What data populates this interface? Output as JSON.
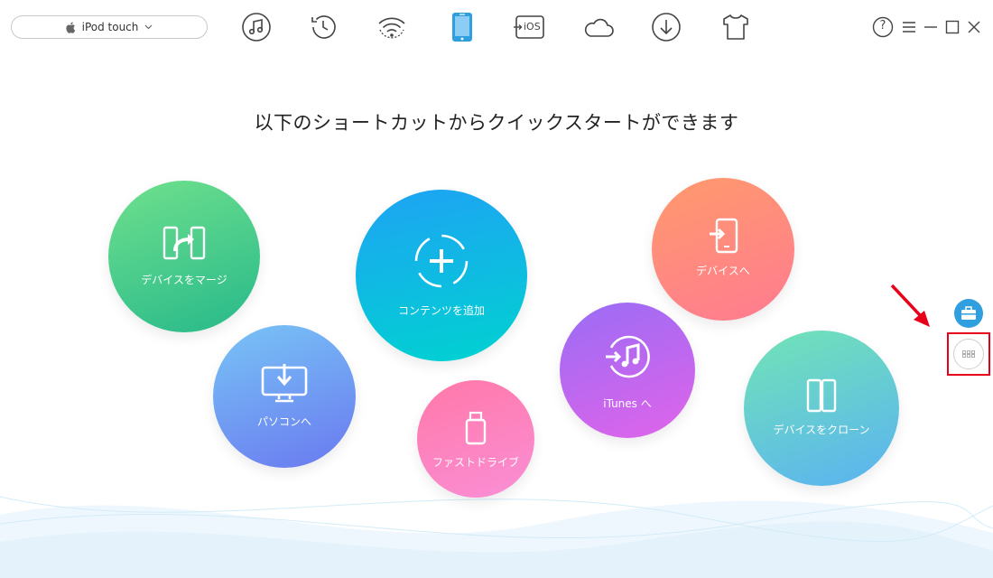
{
  "device_selector": {
    "label": "iPod touch"
  },
  "toolbar": {
    "icons": [
      "music-icon",
      "history-icon",
      "wifi-sync-icon",
      "device-icon",
      "ios-update-icon",
      "cloud-icon",
      "download-icon",
      "tshirt-icon"
    ],
    "active": "device-icon",
    "ios_label": "iOS"
  },
  "window_controls": {
    "help": "?"
  },
  "heading": "以下のショートカットからクイックスタートができます",
  "shortcuts": {
    "merge": "デバイスをマージ",
    "to_pc": "パソコンへ",
    "add_content": "コンテンツを追加",
    "fast_drive": "ファストドライブ",
    "to_itunes": "iTunes へ",
    "to_device": "デバイスへ",
    "clone": "デバイスをクローン"
  },
  "colors": {
    "accent": "#2f9fe0",
    "highlight": "#e8001a"
  }
}
